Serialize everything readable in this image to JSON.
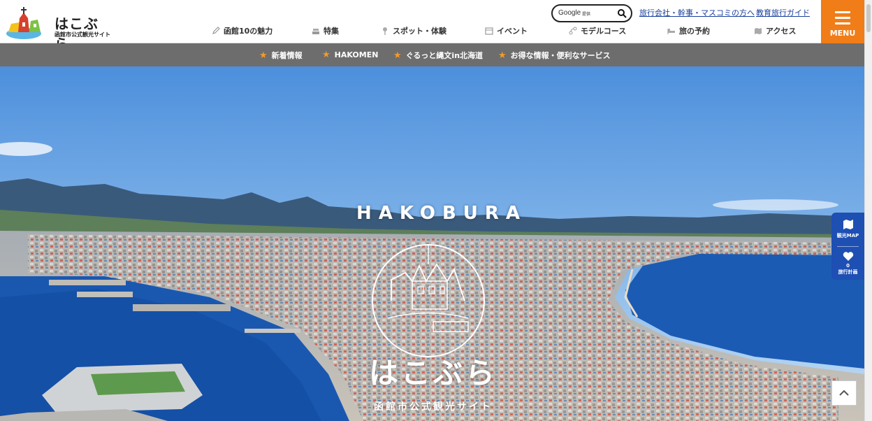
{
  "site": {
    "title": "はこぶら",
    "subtitle": "函館市公式観光サイト"
  },
  "search": {
    "brand": "Google",
    "label": "提供",
    "icon": "search-icon"
  },
  "top_links": [
    {
      "label": "旅行会社・幹事・マスコミの方へ"
    },
    {
      "label": "教育旅行ガイド"
    }
  ],
  "nav": [
    {
      "label": "函館10の魅力",
      "icon": "pencil-icon"
    },
    {
      "label": "特集",
      "icon": "stack-icon"
    },
    {
      "label": "スポット・体験",
      "icon": "pin-icon"
    },
    {
      "label": "イベント",
      "icon": "calendar-icon"
    },
    {
      "label": "モデルコース",
      "icon": "route-icon"
    },
    {
      "label": "旅の予約",
      "icon": "bed-icon"
    },
    {
      "label": "アクセス",
      "icon": "map-icon"
    }
  ],
  "menu": {
    "label": "MENU",
    "color": "#f07d18"
  },
  "subnav": [
    {
      "label": "新着情報"
    },
    {
      "label": "HAKOMEN"
    },
    {
      "label": "ぐるっと縄文in北海道"
    },
    {
      "label": "お得な情報・便利なサービス"
    }
  ],
  "hero": {
    "ring_text": "HAKOBURA",
    "title": "はこぶら",
    "subtitle": "函館市公式観光サイト"
  },
  "side_tools": {
    "map_label": "観光MAP",
    "plan_count": "0",
    "plan_label": "旅行計画"
  },
  "colors": {
    "accent": "#f07d18",
    "subnav_bg": "#6d6d6d",
    "link": "#1a3f9c",
    "side_bg": "#1e4fb3",
    "star": "#f39a2c"
  }
}
